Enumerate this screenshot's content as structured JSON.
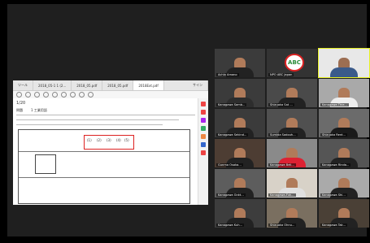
{
  "viewer": {
    "tabs": [
      {
        "label": "ツール"
      },
      {
        "label": "2018_05-1 1 (2..."
      },
      {
        "label": "2018_05.pdf"
      },
      {
        "label": "2018_05.pdf"
      },
      {
        "label": "2018Ext.pdf"
      }
    ],
    "signin": "サイン"
  },
  "doc": {
    "page_marker": "1/20",
    "heading": "問題",
    "subheading": "1 工業用語",
    "annotations": [
      "(1)",
      "(2)",
      "(3)",
      "(4)",
      "(5)"
    ]
  },
  "participants": [
    {
      "name": "Achlo Amano"
    },
    {
      "name": "NPO ABC Japan"
    },
    {
      "name": ""
    },
    {
      "name": "Kanagawa Samb..."
    },
    {
      "name": "Shizuoka Sat ..."
    },
    {
      "name": "Kanagawa Thie..."
    },
    {
      "name": "Kanagawa Sekind..."
    },
    {
      "name": "Sumida Sadouh..."
    },
    {
      "name": "Shizuoka Rent..."
    },
    {
      "name": "Gunma Osaka..."
    },
    {
      "name": "Kanagawa Beli..."
    },
    {
      "name": "Kanagawa Rinda..."
    },
    {
      "name": "Kanagawa Gnkt..."
    },
    {
      "name": "Kanagawa-Fuk..."
    },
    {
      "name": "Kanagawa Shi..."
    },
    {
      "name": "Kanagawa Kuh..."
    },
    {
      "name": "Shizuoka Ohnu..."
    },
    {
      "name": "Kanagawa Tak..."
    }
  ],
  "logo": {
    "text": "ABC"
  },
  "colors": {
    "background": "#000000",
    "annotation": "#dd2222",
    "active_speaker": "#e7f022"
  }
}
